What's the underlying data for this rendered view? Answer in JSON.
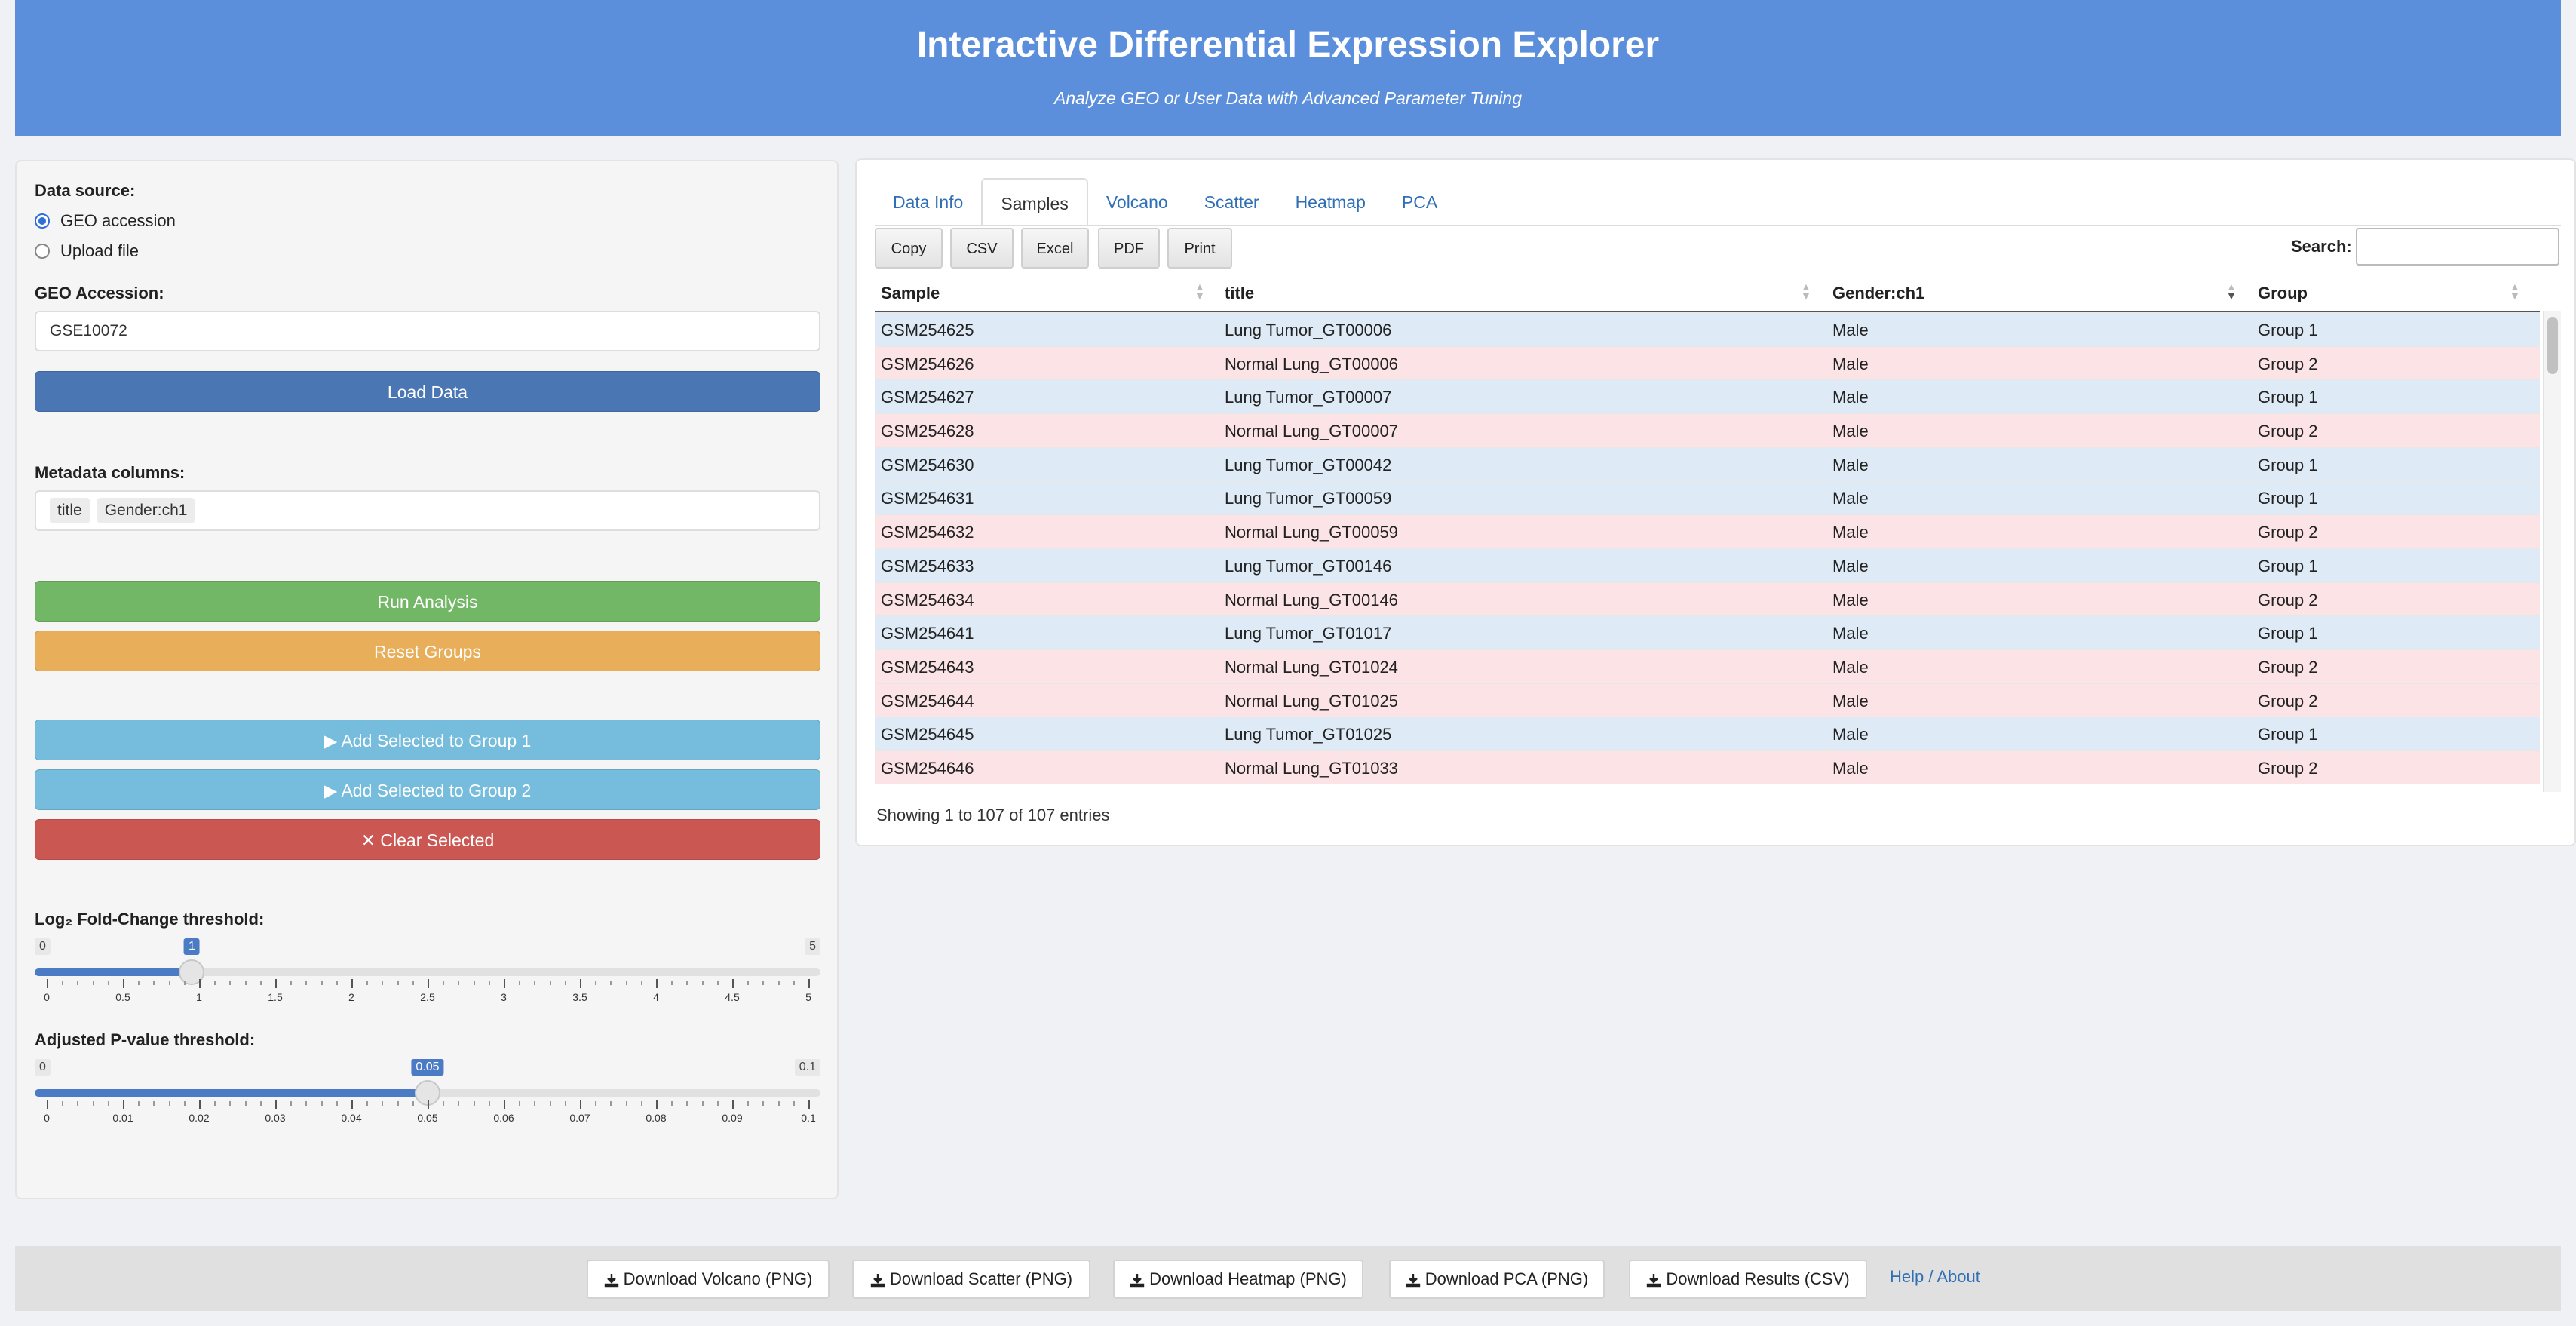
{
  "header": {
    "title": "Interactive Differential Expression Explorer",
    "subtitle": "Analyze GEO or User Data with Advanced Parameter Tuning",
    "bg_color": "#5b8fdc"
  },
  "sidebar": {
    "data_source_label": "Data source:",
    "options": [
      {
        "label": "GEO accession",
        "selected": true
      },
      {
        "label": "Upload file",
        "selected": false
      }
    ],
    "geo_label": "GEO Accession:",
    "geo_value": "GSE10072",
    "load_button": "Load Data",
    "metadata_label": "Metadata columns:",
    "metadata_chips": [
      "title",
      "Gender:ch1"
    ],
    "run_button": "Run Analysis",
    "reset_button": "Reset Groups",
    "add_group1_button": "▶ Add Selected to Group 1",
    "add_group2_button": "▶ Add Selected to Group 2",
    "clear_button": "✕ Clear Selected",
    "colors": {
      "primary": "#4a77b4",
      "success": "#72b765",
      "warning": "#e8ae59",
      "info": "#76bcdc",
      "danger": "#cb5752"
    },
    "fc_slider": {
      "label": "Log₂ Fold-Change threshold:",
      "min": 0,
      "max": 5,
      "value": 1,
      "min_label": "0",
      "max_label": "5",
      "value_label": "1",
      "ticks": [
        "0",
        "0.5",
        "1",
        "1.5",
        "2",
        "2.5",
        "3",
        "3.5",
        "4",
        "4.5",
        "5"
      ]
    },
    "p_slider": {
      "label": "Adjusted P-value threshold:",
      "min": 0,
      "max": 0.1,
      "value": 0.05,
      "min_label": "0",
      "max_label": "0.1",
      "value_label": "0.05",
      "ticks": [
        "0",
        "0.01",
        "0.02",
        "0.03",
        "0.04",
        "0.05",
        "0.06",
        "0.07",
        "0.08",
        "0.09",
        "0.1"
      ]
    }
  },
  "main": {
    "tabs": [
      {
        "label": "Data Info",
        "active": false
      },
      {
        "label": "Samples",
        "active": true
      },
      {
        "label": "Volcano",
        "active": false
      },
      {
        "label": "Scatter",
        "active": false
      },
      {
        "label": "Heatmap",
        "active": false
      },
      {
        "label": "PCA",
        "active": false
      }
    ],
    "table_buttons": [
      "Copy",
      "CSV",
      "Excel",
      "PDF",
      "Print"
    ],
    "search_label": "Search:",
    "search_value": "",
    "columns": [
      "Sample",
      "title",
      "Gender:ch1",
      "Group"
    ],
    "rows": [
      [
        "GSM254625",
        "Lung Tumor_GT00006",
        "Male",
        "Group 1"
      ],
      [
        "GSM254626",
        "Normal Lung_GT00006",
        "Male",
        "Group 2"
      ],
      [
        "GSM254627",
        "Lung Tumor_GT00007",
        "Male",
        "Group 1"
      ],
      [
        "GSM254628",
        "Normal Lung_GT00007",
        "Male",
        "Group 2"
      ],
      [
        "GSM254630",
        "Lung Tumor_GT00042",
        "Male",
        "Group 1"
      ],
      [
        "GSM254631",
        "Lung Tumor_GT00059",
        "Male",
        "Group 1"
      ],
      [
        "GSM254632",
        "Normal Lung_GT00059",
        "Male",
        "Group 2"
      ],
      [
        "GSM254633",
        "Lung Tumor_GT00146",
        "Male",
        "Group 1"
      ],
      [
        "GSM254634",
        "Normal Lung_GT00146",
        "Male",
        "Group 2"
      ],
      [
        "GSM254641",
        "Lung Tumor_GT01017",
        "Male",
        "Group 1"
      ],
      [
        "GSM254643",
        "Normal Lung_GT01024",
        "Male",
        "Group 2"
      ],
      [
        "GSM254644",
        "Normal Lung_GT01025",
        "Male",
        "Group 2"
      ],
      [
        "GSM254645",
        "Lung Tumor_GT01025",
        "Male",
        "Group 1"
      ],
      [
        "GSM254646",
        "Normal Lung_GT01033",
        "Male",
        "Group 2"
      ]
    ],
    "row_colors": {
      "Group 1": "#deebf7",
      "Group 2": "#fce3e6"
    },
    "info": "Showing 1 to 107 of 107 entries"
  },
  "footer": {
    "buttons": [
      "Download Volcano (PNG)",
      "Download Scatter (PNG)",
      "Download Heatmap (PNG)",
      "Download PCA (PNG)",
      "Download Results (CSV)"
    ],
    "help_link": "Help / About"
  }
}
